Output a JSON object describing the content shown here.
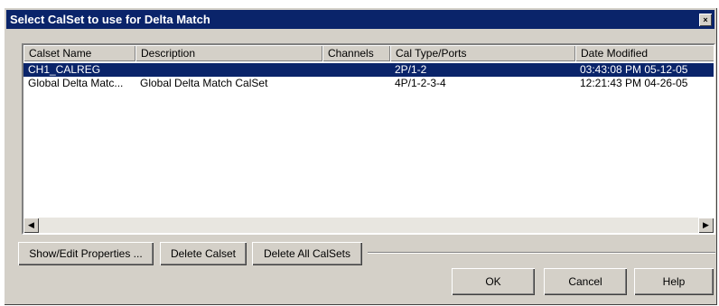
{
  "window": {
    "title": "Select CalSet to use for Delta Match",
    "close_icon": "×"
  },
  "table": {
    "columns": [
      "Calset Name",
      "Description",
      "Channels",
      "Cal Type/Ports",
      "Date Modified"
    ],
    "rows": [
      {
        "name": "CH1_CALREG",
        "description": "",
        "channels": "",
        "cal_type": "2P/1-2",
        "date": "03:43:08 PM  05-12-05",
        "selected": true
      },
      {
        "name": "Global Delta Matc...",
        "description": "Global Delta Match CalSet",
        "channels": "",
        "cal_type": "4P/1-2-3-4",
        "date": "12:21:43 PM  04-26-05",
        "selected": false
      }
    ]
  },
  "scrollbar": {
    "left_arrow": "◀",
    "right_arrow": "▶"
  },
  "buttons": {
    "show_edit": "Show/Edit Properties ...",
    "delete_calset": "Delete Calset",
    "delete_all": "Delete All CalSets",
    "ok": "OK",
    "cancel": "Cancel",
    "help": "Help"
  }
}
